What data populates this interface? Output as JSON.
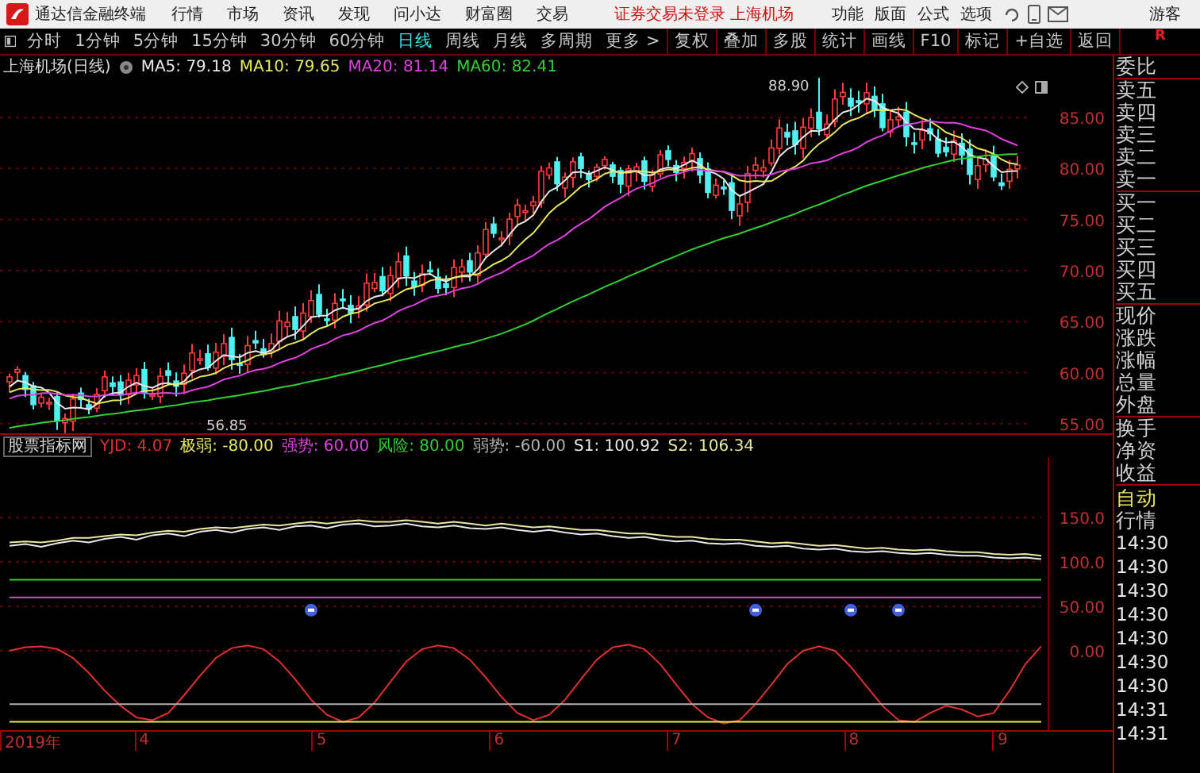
{
  "menubar": {
    "app_title": "通达信金融终端",
    "menus": [
      "行情",
      "市场",
      "资讯",
      "发现",
      "问小达",
      "财富圈",
      "交易"
    ],
    "notice": "证券交易未登录 上海机场",
    "tools": [
      "功能",
      "版面",
      "公式",
      "选项"
    ],
    "user": "游客"
  },
  "toolbar": {
    "periods": [
      {
        "label": "分时",
        "selected": false
      },
      {
        "label": "1分钟",
        "selected": false
      },
      {
        "label": "5分钟",
        "selected": false
      },
      {
        "label": "15分钟",
        "selected": false
      },
      {
        "label": "30分钟",
        "selected": false
      },
      {
        "label": "60分钟",
        "selected": false
      },
      {
        "label": "日线",
        "selected": true
      },
      {
        "label": "周线",
        "selected": false
      },
      {
        "label": "月线",
        "selected": false
      },
      {
        "label": "多周期",
        "selected": false
      },
      {
        "label": "更多 >",
        "selected": false
      }
    ],
    "actions": [
      "复权",
      "叠加",
      "多股",
      "统计",
      "画线",
      "F10",
      "标记",
      "+自选",
      "返回"
    ],
    "corner": "R"
  },
  "price_pane": {
    "title": "上海机场(日线)",
    "ma": [
      {
        "label": "MA5: 79.18",
        "color": "#e8e8e8"
      },
      {
        "label": "MA10: 79.65",
        "color": "#e8e860"
      },
      {
        "label": "MA20: 81.14",
        "color": "#e040e0"
      },
      {
        "label": "MA60: 82.41",
        "color": "#30d030"
      }
    ],
    "axis": [
      "85.00",
      "80.00",
      "75.00",
      "70.00",
      "65.00",
      "60.00",
      "55.00"
    ],
    "high_label": "88.90",
    "low_label": "56.85"
  },
  "indicator_pane": {
    "title": "股票指标网",
    "chart_data": {
      "type": "line",
      "grid": true,
      "ylim": [
        -89.3,
        217.9
      ],
      "yticks": [
        {
          "value": 150,
          "label": "150.0"
        },
        {
          "value": 100,
          "label": "100.0"
        },
        {
          "value": 50,
          "label": "50.00"
        },
        {
          "value": 0,
          "label": "0.00"
        }
      ],
      "series": [
        {
          "name": "YJD: 4.07",
          "color": "#e03030",
          "values": [
            0,
            4,
            5,
            2,
            -8,
            -25,
            -45,
            -62,
            -75,
            -78,
            -70,
            -50,
            -28,
            -8,
            3,
            6,
            2,
            -12,
            -32,
            -55,
            -72,
            -80,
            -75,
            -58,
            -35,
            -12,
            2,
            6,
            3,
            -10,
            -30,
            -52,
            -70,
            -78,
            -72,
            -55,
            -32,
            -10,
            4,
            7,
            2,
            -15,
            -38,
            -60,
            -75,
            -82,
            -78,
            -60,
            -38,
            -15,
            0,
            5,
            0,
            -18,
            -40,
            -62,
            -78,
            -80,
            -70,
            -62,
            -66,
            -74,
            -70,
            -45,
            -15,
            5
          ]
        },
        {
          "name": "极弱: -80.00",
          "color": "#e8e860",
          "values": [
            -80,
            -80,
            -80,
            -80,
            -80,
            -80,
            -80,
            -80,
            -80,
            -80,
            -80,
            -80,
            -80,
            -80,
            -80,
            -80,
            -80,
            -80,
            -80,
            -80,
            -80,
            -80,
            -80,
            -80,
            -80,
            -80,
            -80,
            -80,
            -80,
            -80,
            -80,
            -80,
            -80,
            -80,
            -80,
            -80,
            -80,
            -80,
            -80,
            -80,
            -80,
            -80,
            -80,
            -80,
            -80,
            -80,
            -80,
            -80,
            -80,
            -80,
            -80,
            -80,
            -80,
            -80,
            -80,
            -80,
            -80,
            -80,
            -80,
            -80,
            -80,
            -80,
            -80,
            -80,
            -80,
            -80
          ]
        },
        {
          "name": "强势: 60.00",
          "color": "#e040e0",
          "values": [
            60,
            60,
            60,
            60,
            60,
            60,
            60,
            60,
            60,
            60,
            60,
            60,
            60,
            60,
            60,
            60,
            60,
            60,
            60,
            60,
            60,
            60,
            60,
            60,
            60,
            60,
            60,
            60,
            60,
            60,
            60,
            60,
            60,
            60,
            60,
            60,
            60,
            60,
            60,
            60,
            60,
            60,
            60,
            60,
            60,
            60,
            60,
            60,
            60,
            60,
            60,
            60,
            60,
            60,
            60,
            60,
            60,
            60,
            60,
            60,
            60,
            60,
            60,
            60,
            60,
            60
          ]
        },
        {
          "name": "风险: 80.00",
          "color": "#30d030",
          "values": [
            80,
            80,
            80,
            80,
            80,
            80,
            80,
            80,
            80,
            80,
            80,
            80,
            80,
            80,
            80,
            80,
            80,
            80,
            80,
            80,
            80,
            80,
            80,
            80,
            80,
            80,
            80,
            80,
            80,
            80,
            80,
            80,
            80,
            80,
            80,
            80,
            80,
            80,
            80,
            80,
            80,
            80,
            80,
            80,
            80,
            80,
            80,
            80,
            80,
            80,
            80,
            80,
            80,
            80,
            80,
            80,
            80,
            80,
            80,
            80,
            80,
            80,
            80,
            80,
            80,
            80
          ]
        },
        {
          "name": "弱势: -60.00",
          "color": "#b0b0b0",
          "values": [
            -60,
            -60,
            -60,
            -60,
            -60,
            -60,
            -60,
            -60,
            -60,
            -60,
            -60,
            -60,
            -60,
            -60,
            -60,
            -60,
            -60,
            -60,
            -60,
            -60,
            -60,
            -60,
            -60,
            -60,
            -60,
            -60,
            -60,
            -60,
            -60,
            -60,
            -60,
            -60,
            -60,
            -60,
            -60,
            -60,
            -60,
            -60,
            -60,
            -60,
            -60,
            -60,
            -60,
            -60,
            -60,
            -60,
            -60,
            -60,
            -60,
            -60,
            -60,
            -60,
            -60,
            -60,
            -60,
            -60,
            -60,
            -60,
            -60,
            -60,
            -60,
            -60,
            -60,
            -60,
            -60,
            -60
          ]
        },
        {
          "name": "S1: 100.92",
          "color": "#e8e8e8",
          "values": [
            118,
            120,
            117,
            121,
            124,
            122,
            126,
            128,
            125,
            130,
            132,
            129,
            134,
            136,
            133,
            137,
            139,
            136,
            140,
            141,
            138,
            142,
            143,
            140,
            141,
            143,
            140,
            139,
            141,
            138,
            137,
            139,
            136,
            134,
            136,
            133,
            131,
            132,
            129,
            127,
            128,
            125,
            123,
            124,
            121,
            120,
            121,
            118,
            117,
            118,
            115,
            114,
            115,
            112,
            111,
            112,
            110,
            109,
            110,
            108,
            107,
            107,
            105,
            104,
            105,
            103
          ]
        },
        {
          "name": "S2: 106.34",
          "color": "#e8e8a0",
          "values": [
            122,
            123,
            122,
            124,
            127,
            127,
            129,
            131,
            130,
            133,
            135,
            134,
            137,
            139,
            138,
            140,
            142,
            141,
            143,
            145,
            143,
            145,
            147,
            145,
            145,
            147,
            145,
            143,
            145,
            143,
            141,
            143,
            141,
            139,
            140,
            138,
            136,
            136,
            134,
            132,
            132,
            130,
            128,
            128,
            126,
            125,
            125,
            123,
            121,
            122,
            120,
            118,
            119,
            117,
            115,
            116,
            114,
            113,
            114,
            112,
            111,
            111,
            109,
            108,
            109,
            107
          ]
        }
      ]
    }
  },
  "time_axis": [
    "2019年",
    "4",
    "5",
    "6",
    "7",
    "8",
    "9"
  ],
  "quote_panel": {
    "labels": [
      "委比",
      "卖五",
      "卖四",
      "卖三",
      "卖二",
      "卖一",
      "买一",
      "买二",
      "买三",
      "买四",
      "买五",
      "现价",
      "涨跌",
      "涨幅",
      "总量",
      "外盘",
      "换手",
      "净资",
      "收益"
    ],
    "auto": "自动",
    "section": "行情",
    "times": [
      "14:30",
      "14:30",
      "14:30",
      "14:30",
      "14:30",
      "14:30",
      "14:30",
      "14:31",
      "14:31"
    ]
  }
}
